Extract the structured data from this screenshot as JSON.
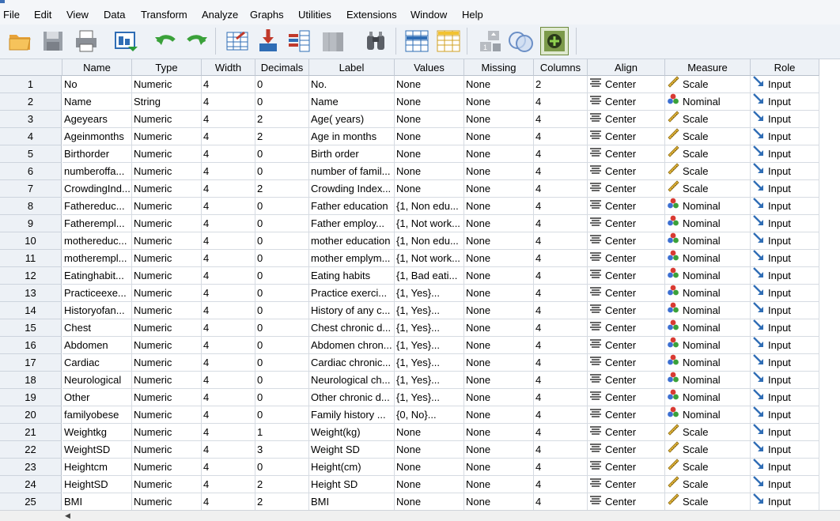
{
  "menu": [
    "File",
    "Edit",
    "View",
    "Data",
    "Transform",
    "Analyze",
    "Graphs",
    "Utilities",
    "Extensions",
    "Window",
    "Help"
  ],
  "toolbar": [
    "open-folder-icon",
    "save-icon",
    "print-icon",
    "recall-dialog-icon",
    "undo-icon",
    "redo-icon",
    "goto-case-icon",
    "goto-variable-icon",
    "variables-icon",
    "run-descriptives-icon",
    "find-icon",
    "insert-cases-icon",
    "insert-variable-icon",
    "split-file-icon",
    "select-cases-icon",
    "value-labels-icon"
  ],
  "columns": [
    "Name",
    "Type",
    "Width",
    "Decimals",
    "Label",
    "Values",
    "Missing",
    "Columns",
    "Align",
    "Measure",
    "Role"
  ],
  "rows": [
    [
      "1",
      "No",
      "Numeric",
      "4",
      "0",
      "No.",
      "None",
      "None",
      "2",
      "Center",
      "Scale",
      "Input"
    ],
    [
      "2",
      "Name",
      "String",
      "4",
      "0",
      "Name",
      "None",
      "None",
      "4",
      "Center",
      "Nominal",
      "Input"
    ],
    [
      "3",
      "Ageyears",
      "Numeric",
      "4",
      "2",
      "Age( years)",
      "None",
      "None",
      "4",
      "Center",
      "Scale",
      "Input"
    ],
    [
      "4",
      "Ageinmonths",
      "Numeric",
      "4",
      "2",
      "Age in months",
      "None",
      "None",
      "4",
      "Center",
      "Scale",
      "Input"
    ],
    [
      "5",
      "Birthorder",
      "Numeric",
      "4",
      "0",
      "Birth order",
      "None",
      "None",
      "4",
      "Center",
      "Scale",
      "Input"
    ],
    [
      "6",
      "numberoffa...",
      "Numeric",
      "4",
      "0",
      "number of famil...",
      "None",
      "None",
      "4",
      "Center",
      "Scale",
      "Input"
    ],
    [
      "7",
      "CrowdingInd...",
      "Numeric",
      "4",
      "2",
      "Crowding Index...",
      "None",
      "None",
      "4",
      "Center",
      "Scale",
      "Input"
    ],
    [
      "8",
      "Fathereduc...",
      "Numeric",
      "4",
      "0",
      "Father education",
      "{1, Non edu...",
      "None",
      "4",
      "Center",
      "Nominal",
      "Input"
    ],
    [
      "9",
      "Fatherempl...",
      "Numeric",
      "4",
      "0",
      "Father employ...",
      "{1, Not work...",
      "None",
      "4",
      "Center",
      "Nominal",
      "Input"
    ],
    [
      "10",
      "mothereduc...",
      "Numeric",
      "4",
      "0",
      "mother education",
      "{1, Non edu...",
      "None",
      "4",
      "Center",
      "Nominal",
      "Input"
    ],
    [
      "11",
      "motherempl...",
      "Numeric",
      "4",
      "0",
      "mother emplym...",
      "{1, Not work...",
      "None",
      "4",
      "Center",
      "Nominal",
      "Input"
    ],
    [
      "12",
      "Eatinghabit...",
      "Numeric",
      "4",
      "0",
      "Eating habits",
      "{1, Bad eati...",
      "None",
      "4",
      "Center",
      "Nominal",
      "Input"
    ],
    [
      "13",
      "Practiceexe...",
      "Numeric",
      "4",
      "0",
      "Practice exerci...",
      "{1, Yes}...",
      "None",
      "4",
      "Center",
      "Nominal",
      "Input"
    ],
    [
      "14",
      "Historyofan...",
      "Numeric",
      "4",
      "0",
      "History of any c...",
      "{1, Yes}...",
      "None",
      "4",
      "Center",
      "Nominal",
      "Input"
    ],
    [
      "15",
      "Chest",
      "Numeric",
      "4",
      "0",
      "Chest chronic d...",
      "{1, Yes}...",
      "None",
      "4",
      "Center",
      "Nominal",
      "Input"
    ],
    [
      "16",
      "Abdomen",
      "Numeric",
      "4",
      "0",
      "Abdomen chron...",
      "{1, Yes}...",
      "None",
      "4",
      "Center",
      "Nominal",
      "Input"
    ],
    [
      "17",
      "Cardiac",
      "Numeric",
      "4",
      "0",
      "Cardiac chronic...",
      "{1, Yes}...",
      "None",
      "4",
      "Center",
      "Nominal",
      "Input"
    ],
    [
      "18",
      "Neurological",
      "Numeric",
      "4",
      "0",
      "Neurological ch...",
      "{1, Yes}...",
      "None",
      "4",
      "Center",
      "Nominal",
      "Input"
    ],
    [
      "19",
      "Other",
      "Numeric",
      "4",
      "0",
      "Other chronic d...",
      "{1, Yes}...",
      "None",
      "4",
      "Center",
      "Nominal",
      "Input"
    ],
    [
      "20",
      "familyobese",
      "Numeric",
      "4",
      "0",
      "Family history ...",
      "{0, No}...",
      "None",
      "4",
      "Center",
      "Nominal",
      "Input"
    ],
    [
      "21",
      "Weightkg",
      "Numeric",
      "4",
      "1",
      "Weight(kg)",
      "None",
      "None",
      "4",
      "Center",
      "Scale",
      "Input"
    ],
    [
      "22",
      "WeightSD",
      "Numeric",
      "4",
      "3",
      "Weight SD",
      "None",
      "None",
      "4",
      "Center",
      "Scale",
      "Input"
    ],
    [
      "23",
      "Heightcm",
      "Numeric",
      "4",
      "0",
      "Height(cm)",
      "None",
      "None",
      "4",
      "Center",
      "Scale",
      "Input"
    ],
    [
      "24",
      "HeightSD",
      "Numeric",
      "4",
      "2",
      "Height SD",
      "None",
      "None",
      "4",
      "Center",
      "Scale",
      "Input"
    ],
    [
      "25",
      "BMI",
      "Numeric",
      "4",
      "2",
      "BMI",
      "None",
      "None",
      "4",
      "Center",
      "Scale",
      "Input"
    ]
  ]
}
